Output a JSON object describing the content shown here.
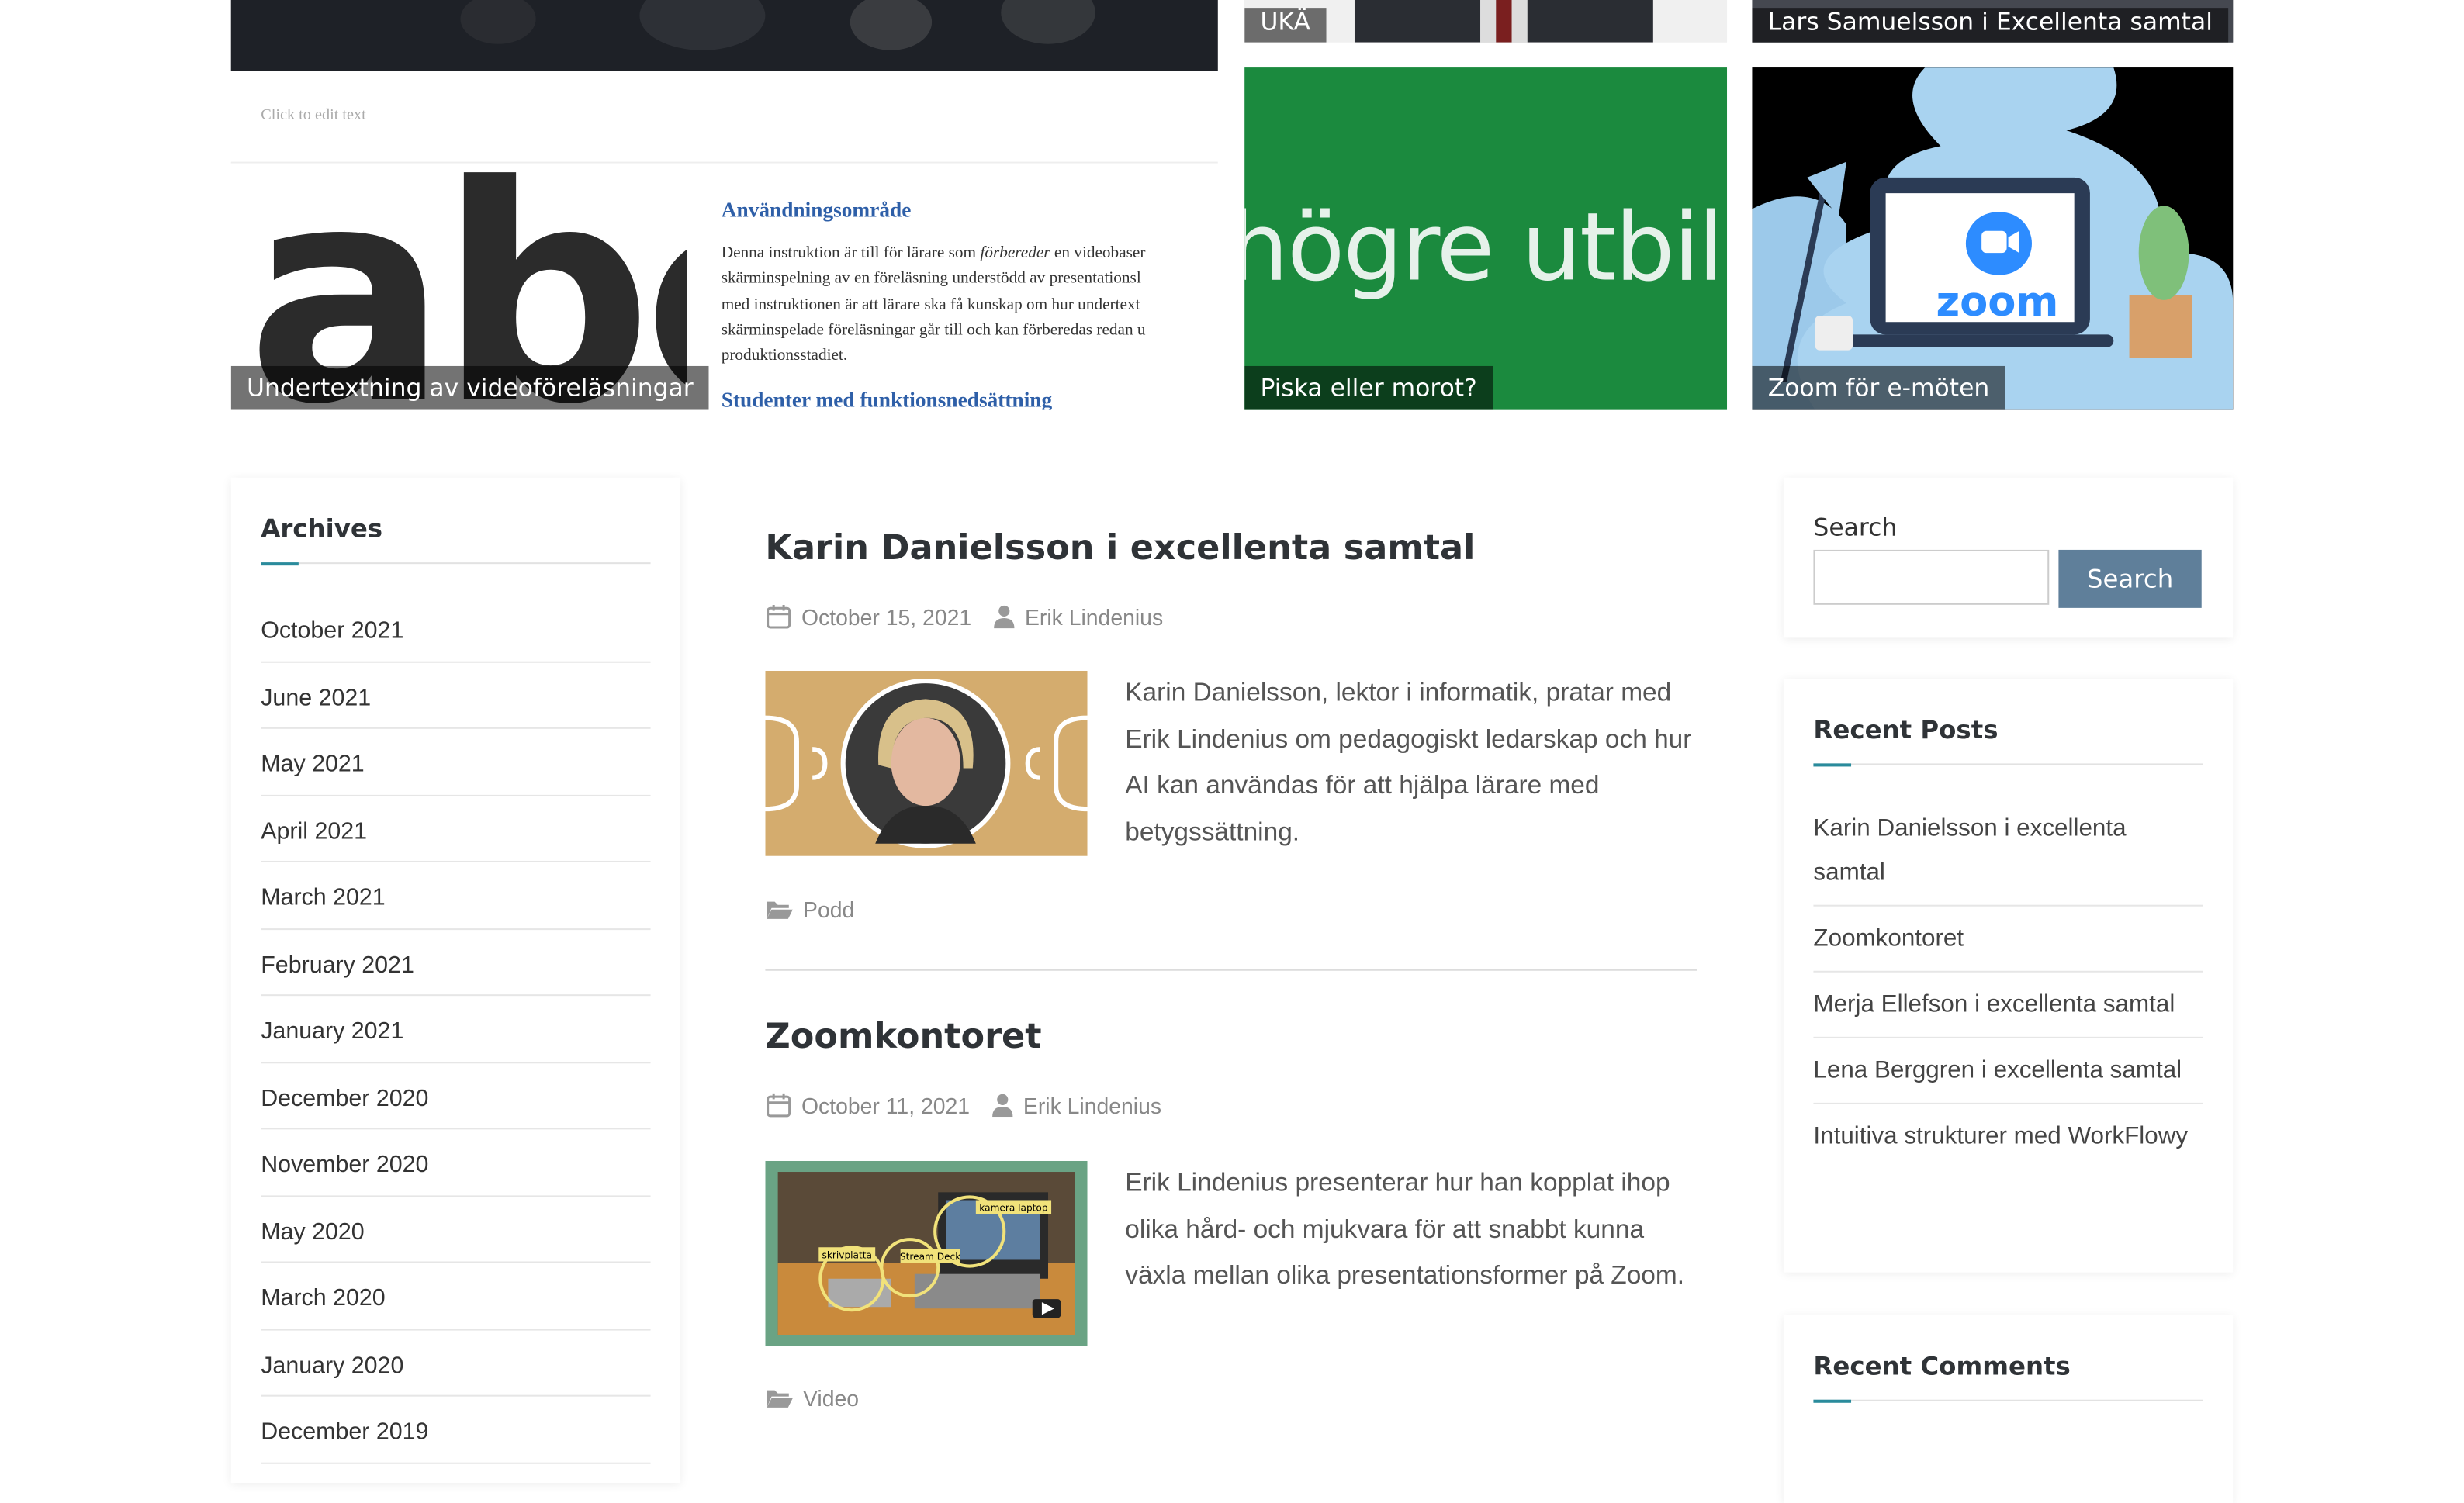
{
  "featured": {
    "uka_label": "UKÄ",
    "lars_label": "Lars Samuelsson i Excellenta samtal",
    "edit_hint": "Click to edit text",
    "abc_label": "Undertextning av videoföreläsningar",
    "abc_big_text": "abc",
    "doc_heading": "Användningsområde",
    "doc_lines": [
      "Denna instruktion är till för lärare som",
      "förbereder",
      "en videobaser",
      "skärminspelning av en föreläsning understödd av presentationsl",
      "med instruktionen är att lärare ska få kunskap om hur undertext",
      "skärminspelade föreläsningar går till och kan förberedas redan u",
      "produktionsstadiet."
    ],
    "doc_heading2": "Studenter med funktionsnedsättning",
    "green_text": "högre utbildn",
    "green_label": "Piska eller morot?",
    "zoom_logo": "zoom",
    "zoom_label": "Zoom för e-möten"
  },
  "archives": {
    "title": "Archives",
    "items": [
      "October 2021",
      "June 2021",
      "May 2021",
      "April 2021",
      "March 2021",
      "February 2021",
      "January 2021",
      "December 2020",
      "November 2020",
      "May 2020",
      "March 2020",
      "January 2020",
      "December 2019"
    ]
  },
  "posts": [
    {
      "title": "Karin Danielsson i excellenta samtal",
      "date": "October 15, 2021",
      "author": "Erik Lindenius",
      "excerpt": "Karin Danielsson, lektor i informatik, pratar med Erik Lindenius om pedagogiskt ledarskap och hur AI kan användas för att hjälpa lärare med betygssättning.",
      "category": "Podd"
    },
    {
      "title": "Zoomkontoret",
      "date": "October 11, 2021",
      "author": "Erik Lindenius",
      "excerpt": "Erik Lindenius presenterar hur han kopplat ihop olika hård- och mjukvara för att snabbt kunna växla mellan olika presentationsformer på Zoom.",
      "category": "Video",
      "thumb_labels": [
        "kamera laptop",
        "skrivplatta",
        "Stream Deck"
      ]
    }
  ],
  "search": {
    "label": "Search",
    "button": "Search",
    "value": ""
  },
  "recent_posts": {
    "title": "Recent Posts",
    "items": [
      "Karin Danielsson i excellenta samtal",
      "Zoomkontoret",
      "Merja Ellefson i excellenta samtal",
      "Lena Berggren i excellenta samtal",
      "Intuitiva strukturer med WorkFlowy"
    ]
  },
  "recent_comments": {
    "title": "Recent Comments"
  },
  "colors": {
    "accent": "#2a8b9c",
    "button": "#5f7f9a",
    "green_tile": "#1b8a3e",
    "podd_bg": "#d4ac6e"
  }
}
